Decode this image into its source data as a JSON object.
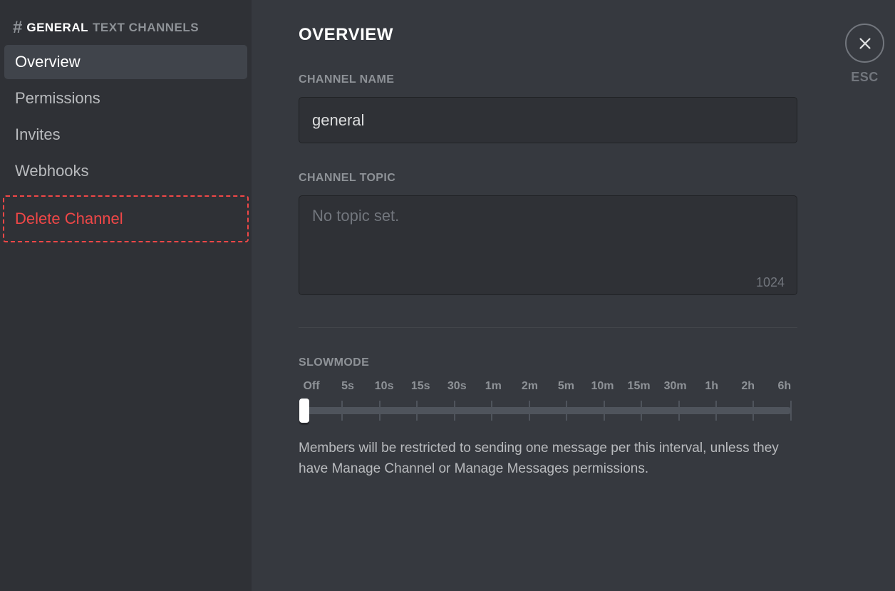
{
  "sidebar": {
    "hash": "#",
    "channelName": "GENERAL",
    "category": "TEXT CHANNELS",
    "items": [
      {
        "label": "Overview",
        "active": true
      },
      {
        "label": "Permissions",
        "active": false
      },
      {
        "label": "Invites",
        "active": false
      },
      {
        "label": "Webhooks",
        "active": false
      }
    ],
    "deleteLabel": "Delete Channel"
  },
  "main": {
    "title": "OVERVIEW",
    "channelNameLabel": "CHANNEL NAME",
    "channelNameValue": "general",
    "channelTopicLabel": "CHANNEL TOPIC",
    "channelTopicPlaceholder": "No topic set.",
    "channelTopicValue": "",
    "charCount": "1024",
    "slowmodeLabel": "SLOWMODE",
    "slowmodeTicks": [
      "Off",
      "5s",
      "10s",
      "15s",
      "30s",
      "1m",
      "2m",
      "5m",
      "10m",
      "15m",
      "30m",
      "1h",
      "2h",
      "6h"
    ],
    "slowmodeHelp": "Members will be restricted to sending one message per this interval, unless they have Manage Channel or Manage Messages permissions."
  },
  "close": {
    "esc": "ESC"
  }
}
